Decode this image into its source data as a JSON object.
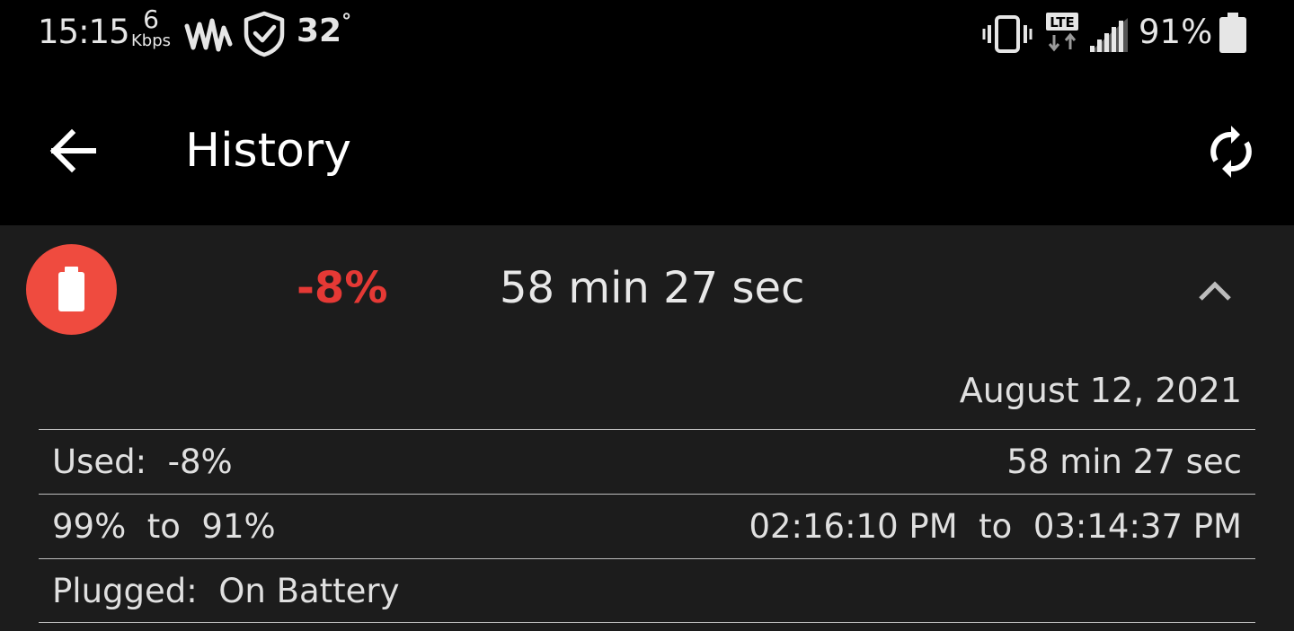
{
  "status_bar": {
    "time": "15:15",
    "speed_value": "6",
    "speed_unit": "Kbps",
    "temperature": "32",
    "temperature_unit": "°",
    "network": "LTE",
    "battery_percent": "91%"
  },
  "app_bar": {
    "title": "History"
  },
  "entry": {
    "percent_change": "-8%",
    "duration": "58 min 27 sec",
    "date": "August 12, 2021",
    "used_label": "Used:  -8%",
    "used_duration": "58 min 27 sec",
    "level_range": "99%  to  91%",
    "time_range": "02:16:10 PM  to  03:14:37 PM",
    "plugged_label": "Plugged:  On Battery"
  },
  "colors": {
    "accent_red": "#ef4b3f",
    "change_red": "#e53935",
    "background": "#000000",
    "card": "#1c1c1c"
  },
  "icons": {
    "back": "arrow-left-icon",
    "refresh": "sync-icon",
    "collapse": "chevron-up-icon",
    "battery": "battery-icon"
  }
}
